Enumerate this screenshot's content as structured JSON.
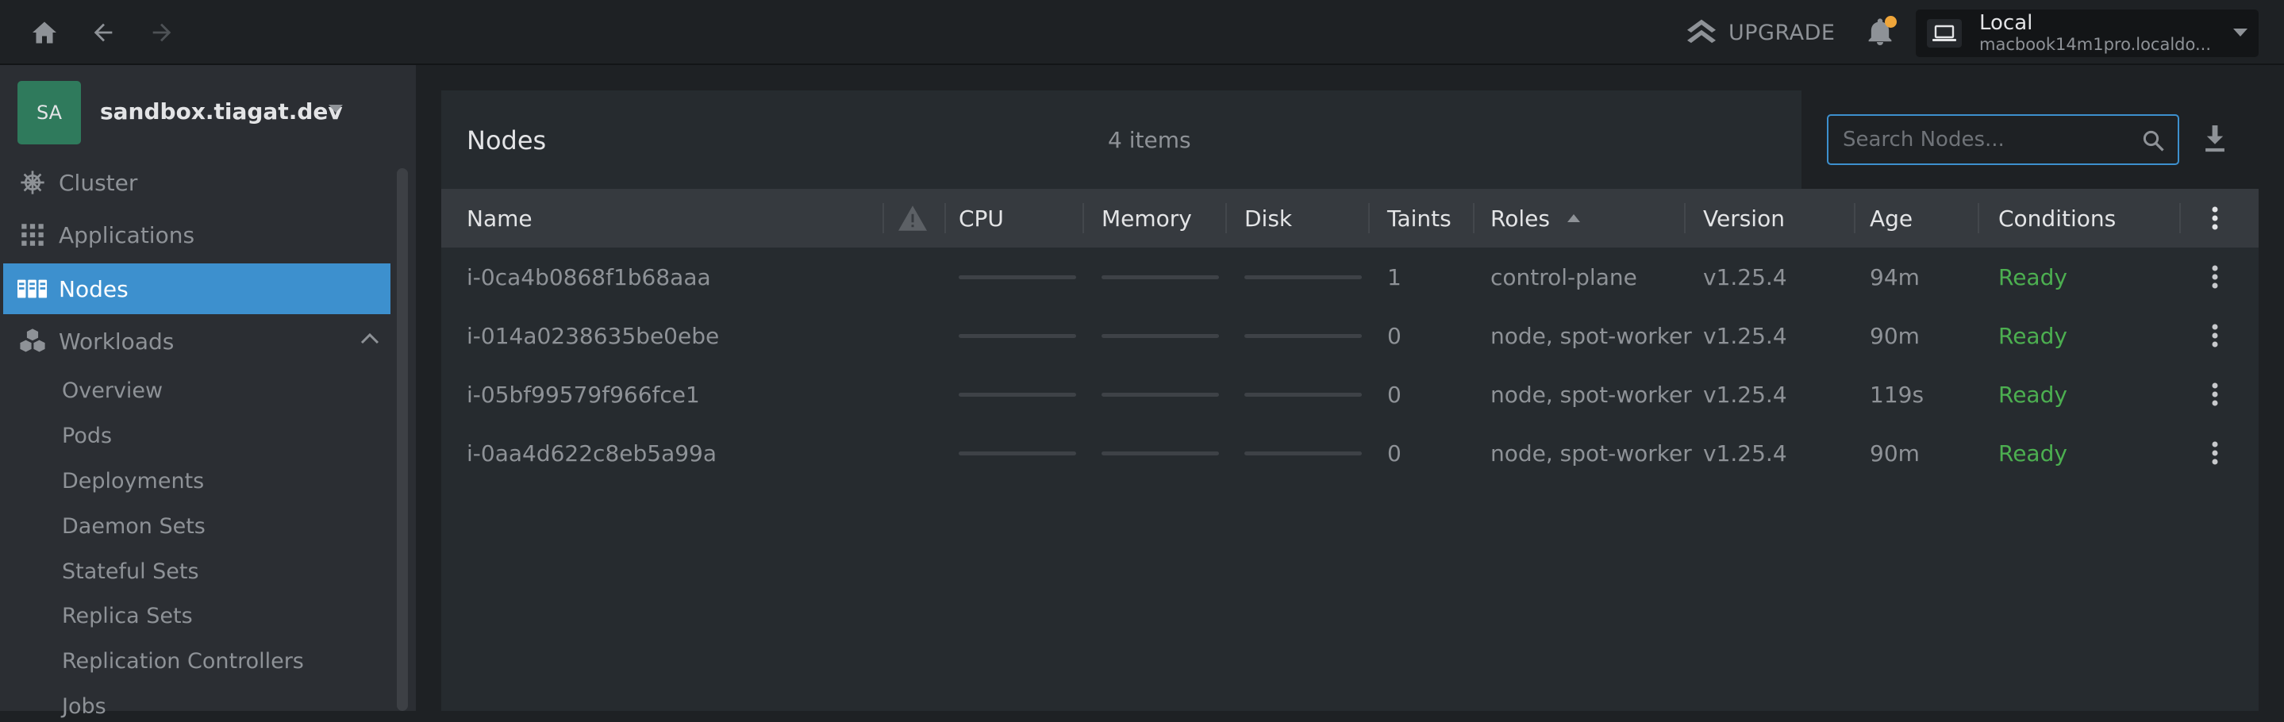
{
  "topbar": {
    "upgrade_label": "UPGRADE",
    "cluster": {
      "name": "Local",
      "host": "macbook14m1pro.localdo..."
    }
  },
  "sidebar": {
    "avatar_initials": "SA",
    "cluster_name": "sandbox.tiagat.dev",
    "items": [
      {
        "label": "Cluster",
        "icon": "helm-wheel-icon"
      },
      {
        "label": "Applications",
        "icon": "grid-icon"
      },
      {
        "label": "Nodes",
        "icon": "server-rack-icon",
        "active": true
      },
      {
        "label": "Workloads",
        "icon": "cubes-icon",
        "expanded": true
      }
    ],
    "workloads": [
      "Overview",
      "Pods",
      "Deployments",
      "Daemon Sets",
      "Stateful Sets",
      "Replica Sets",
      "Replication Controllers",
      "Jobs"
    ]
  },
  "main": {
    "title": "Nodes",
    "count": "4 items",
    "search_placeholder": "Search Nodes...",
    "columns": {
      "name": "Name",
      "cpu": "CPU",
      "memory": "Memory",
      "disk": "Disk",
      "taints": "Taints",
      "roles": "Roles",
      "version": "Version",
      "age": "Age",
      "conditions": "Conditions"
    },
    "rows": [
      {
        "name": "i-0ca4b0868f1b68aaa",
        "taints": "1",
        "roles": "control-plane",
        "version": "v1.25.4",
        "age": "94m",
        "conditions": "Ready"
      },
      {
        "name": "i-014a0238635be0ebe",
        "taints": "0",
        "roles": "node, spot-worker",
        "version": "v1.25.4",
        "age": "90m",
        "conditions": "Ready"
      },
      {
        "name": "i-05bf99579f966fce1",
        "taints": "0",
        "roles": "node, spot-worker",
        "version": "v1.25.4",
        "age": "119s",
        "conditions": "Ready"
      },
      {
        "name": "i-0aa4d622c8eb5a99a",
        "taints": "0",
        "roles": "node, spot-worker",
        "version": "v1.25.4",
        "age": "90m",
        "conditions": "Ready"
      }
    ]
  },
  "colors": {
    "accent": "#3d90ce",
    "ready": "#4caf50",
    "notification": "#f0a63a",
    "avatar": "#2f7a5c"
  }
}
